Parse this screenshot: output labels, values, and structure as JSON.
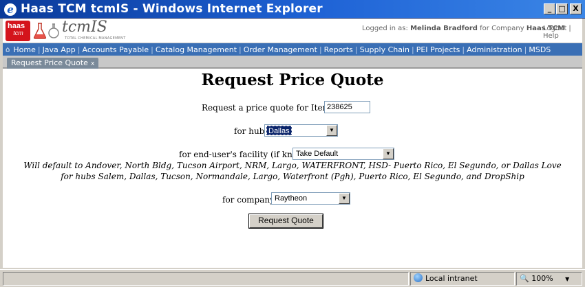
{
  "window": {
    "title": "Haas TCM tcmIS - Windows Internet Explorer",
    "minimize": "_",
    "maximize": "□",
    "close": "X"
  },
  "header": {
    "logo_main": "haas",
    "logo_sub": "tcm",
    "product": "tcmIS",
    "tagline": "TOTAL CHEMICAL MANAGEMENT",
    "logged_in_prefix": "Logged in as:",
    "user": "Melinda Bradford",
    "company_prefix": "for Company",
    "company": "Haas TCM",
    "logout": "Logout",
    "help": "Help"
  },
  "nav": [
    "Home",
    "Java App",
    "Accounts Payable",
    "Catalog Management",
    "Order Management",
    "Reports",
    "Supply Chain",
    "PEI Projects",
    "Administration",
    "MSDS"
  ],
  "tab": {
    "label": "Request Price Quote",
    "close": "x"
  },
  "form": {
    "title": "Request Price Quote",
    "item_label": "Request a price quote for Item ID",
    "item_value": "238625",
    "hub_label": "for hub",
    "hub_value": "Dallas",
    "facility_label": "for end-user's facility (if known)",
    "facility_value": "Take Default",
    "note_line1": "Will default to Andover, North Bldg, Tucson Airport, NRM, Largo, WATERFRONT, HSD- Puerto Rico, El Segundo, or Dallas Love",
    "note_line2": "for hubs Salem, Dallas, Tucson, Normandale, Largo, Waterfront (Pgh), Puerto Rico, El Segundo, and DropShip",
    "company_label": "for company",
    "company_value": "Raytheon",
    "submit": "Request Quote"
  },
  "status": {
    "zone": "Local intranet",
    "zoom": "100%"
  },
  "colors": {
    "title_bar": "#1f63d6",
    "nav_bar": "#3a6fb5",
    "logo_red": "#d4141c"
  }
}
